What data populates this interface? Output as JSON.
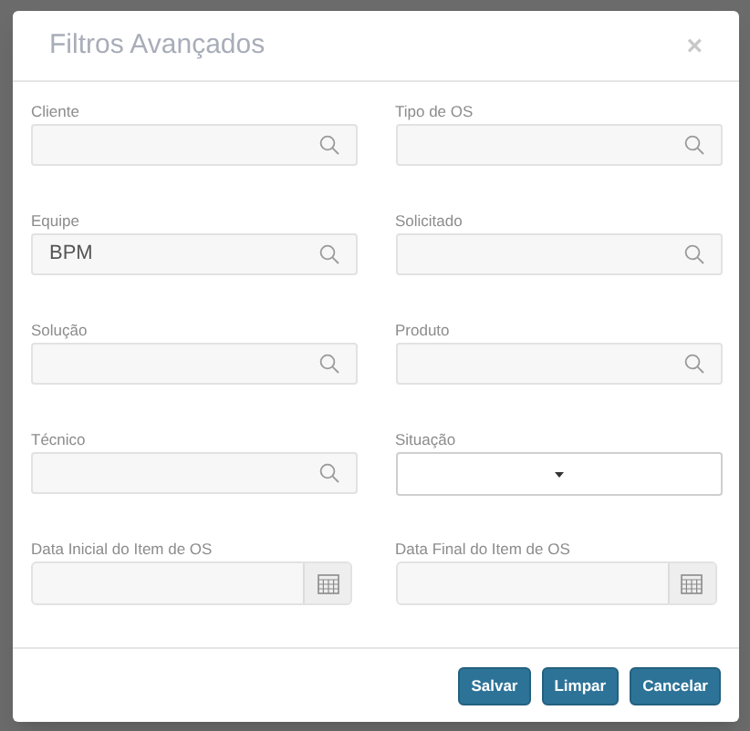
{
  "dialog": {
    "title": "Filtros Avançados",
    "close": "×"
  },
  "fields": [
    {
      "label": "Cliente",
      "kind": "search"
    },
    {
      "label": "Tipo de OS",
      "kind": "search"
    },
    {
      "label": "Equipe",
      "kind": "search",
      "value": "BPM"
    },
    {
      "label": "Solicitado",
      "kind": "search"
    },
    {
      "label": "Solução",
      "kind": "search"
    },
    {
      "label": "Produto",
      "kind": "search"
    },
    {
      "label": "Técnico",
      "kind": "search"
    },
    {
      "label": "Situação",
      "kind": "select"
    },
    {
      "label": "Data Inicial do Item de OS",
      "kind": "date"
    },
    {
      "label": "Data Final do Item de OS",
      "kind": "date"
    }
  ],
  "buttons": [
    "Salvar",
    "Limpar",
    "Cancelar"
  ]
}
